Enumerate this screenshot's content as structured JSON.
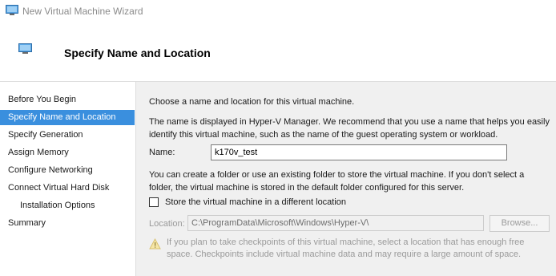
{
  "window": {
    "title": "New Virtual Machine Wizard",
    "icon": "hyper-v-monitor-icon"
  },
  "header": {
    "title": "Specify Name and Location",
    "icon": "hyper-v-monitor-icon"
  },
  "sidebar": {
    "items": [
      {
        "label": "Before You Begin",
        "active": false,
        "sub": false
      },
      {
        "label": "Specify Name and Location",
        "active": true,
        "sub": false
      },
      {
        "label": "Specify Generation",
        "active": false,
        "sub": false
      },
      {
        "label": "Assign Memory",
        "active": false,
        "sub": false
      },
      {
        "label": "Configure Networking",
        "active": false,
        "sub": false
      },
      {
        "label": "Connect Virtual Hard Disk",
        "active": false,
        "sub": false
      },
      {
        "label": "Installation Options",
        "active": false,
        "sub": true
      },
      {
        "label": "Summary",
        "active": false,
        "sub": false
      }
    ]
  },
  "main": {
    "intro": "Choose a name and location for this virtual machine.",
    "name_help": "The name is displayed in Hyper-V Manager. We recommend that you use a name that helps you easily identify this virtual machine, such as the name of the guest operating system or workload.",
    "name_label": "Name:",
    "name_value": "k170v_test",
    "folder_help": "You can create a folder or use an existing folder to store the virtual machine. If you don't select a folder, the virtual machine is stored in the default folder configured for this server.",
    "store_checkbox_label": "Store the virtual machine in a different location",
    "store_checked": false,
    "location_label": "Location:",
    "location_value": "C:\\ProgramData\\Microsoft\\Windows\\Hyper-V\\",
    "browse_label": "Browse...",
    "warning_icon": "warning-triangle-icon",
    "warning_text": "If you plan to take checkpoints of this virtual machine, select a location that has enough free space. Checkpoints include virtual machine data and may require a large amount of space."
  },
  "colors": {
    "accent": "#3a8fde",
    "content_bg": "#f0f0f0",
    "disabled_text": "#9a9a9a"
  }
}
